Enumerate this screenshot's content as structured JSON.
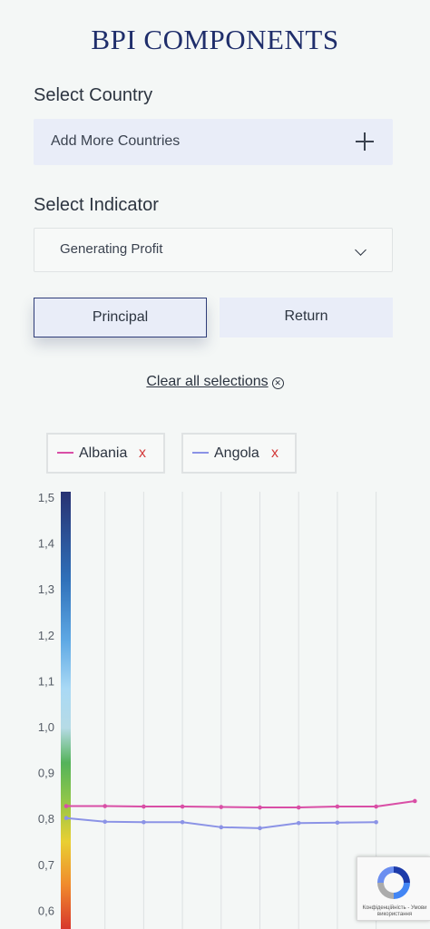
{
  "page": {
    "title": "BPI COMPONENTS"
  },
  "country": {
    "label": "Select Country",
    "add_label": "Add More Countries",
    "icon": "plus-icon"
  },
  "indicator": {
    "label": "Select Indicator",
    "selected": "Generating Profit",
    "icon": "chevron-down-icon"
  },
  "tabs": [
    {
      "label": "Principal",
      "active": true
    },
    {
      "label": "Return",
      "active": false
    }
  ],
  "clear": {
    "label": "Clear all selections",
    "icon": "close-circle-icon"
  },
  "legend": [
    {
      "name": "Albania",
      "remove": "x",
      "color": "#d94fa6"
    },
    {
      "name": "Angola",
      "remove": "x",
      "color": "#8b93e6"
    }
  ],
  "chart_data": {
    "type": "line",
    "title": "",
    "xlabel": "",
    "ylabel": "",
    "ylim": [
      0.55,
      1.5
    ],
    "y_ticks": [
      "1,5",
      "1,4",
      "1,3",
      "1,2",
      "1,1",
      "1,0",
      "0,9",
      "0,8",
      "0,7",
      "0,6"
    ],
    "y_tick_values": [
      1.5,
      1.4,
      1.3,
      1.2,
      1.1,
      1.0,
      0.9,
      0.8,
      0.7,
      0.6
    ],
    "grid": true,
    "color_scale": true,
    "series": [
      {
        "name": "Albania",
        "color": "#d94fa6",
        "values": [
          0.827,
          0.827,
          0.826,
          0.826,
          0.825,
          0.824,
          0.824,
          0.826,
          0.826,
          0.838
        ]
      },
      {
        "name": "Angola",
        "color": "#8b93e6",
        "values": [
          0.801,
          0.793,
          0.792,
          0.792,
          0.781,
          0.779,
          0.79,
          0.791,
          0.792
        ]
      }
    ]
  },
  "recaptcha": {
    "terms": "Конфіденційність - Умови використання",
    "icon": "recaptcha-icon"
  }
}
